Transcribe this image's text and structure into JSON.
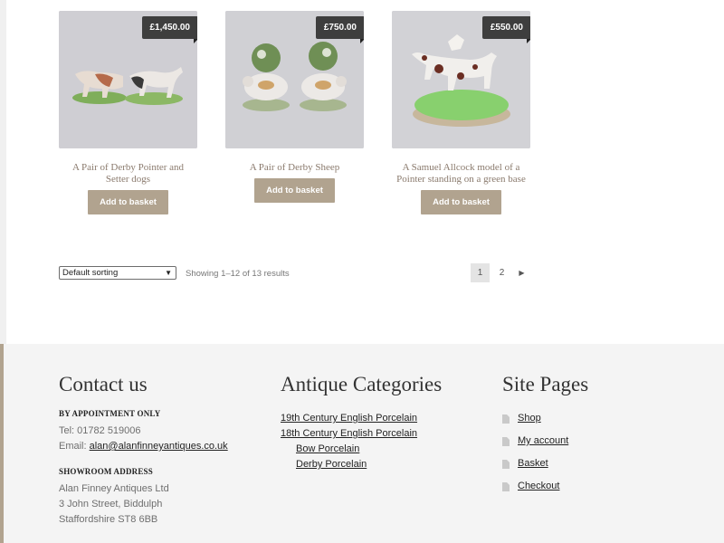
{
  "products": [
    {
      "price": "£1,450.00",
      "title": "A Pair of Derby Pointer and Setter dogs",
      "button": "Add to basket"
    },
    {
      "price": "£750.00",
      "title": "A Pair of Derby Sheep",
      "button": "Add to basket"
    },
    {
      "price": "£550.00",
      "title": "A Samuel Allcock model of a Pointer standing on a green base",
      "button": "Add to basket"
    }
  ],
  "sorting": {
    "selected": "Default sorting"
  },
  "results_text": "Showing 1–12 of 13 results",
  "pagination": {
    "pages": [
      "1",
      "2"
    ],
    "current": "1",
    "next_icon": "chevron-right-icon"
  },
  "footer": {
    "contact": {
      "heading": "Contact us",
      "appointment_label": "BY APPOINTMENT ONLY",
      "tel": "Tel: 01782 519006",
      "email_prefix": "Email: ",
      "email": "alan@alanfinneyantiques.co.uk",
      "showroom_label": "SHOWROOM ADDRESS",
      "address": [
        "Alan Finney Antiques Ltd",
        "3 John Street, Biddulph",
        "Staffordshire ST8 6BB"
      ]
    },
    "categories": {
      "heading": "Antique Categories",
      "items": [
        "19th Century English Porcelain",
        "18th Century English Porcelain",
        "Bow Porcelain",
        "Derby Porcelain"
      ]
    },
    "site_pages": {
      "heading": "Site Pages",
      "items": [
        "Shop",
        "My account",
        "Basket",
        "Checkout"
      ]
    }
  },
  "colors": {
    "accent": "#b1a38f",
    "price_badge": "#3e3e3e",
    "footer_bg": "#f4f4f4"
  }
}
